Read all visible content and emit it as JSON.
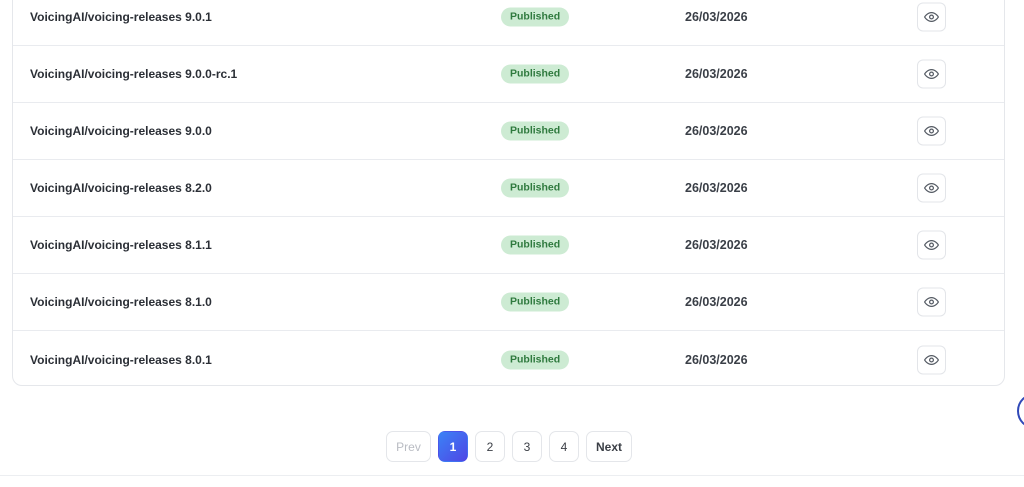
{
  "releases": [
    {
      "name": "VoicingAI/voicing-releases 9.0.1",
      "status": "Published",
      "date": "26/03/2026"
    },
    {
      "name": "VoicingAI/voicing-releases 9.0.0-rc.1",
      "status": "Published",
      "date": "26/03/2026"
    },
    {
      "name": "VoicingAI/voicing-releases 9.0.0",
      "status": "Published",
      "date": "26/03/2026"
    },
    {
      "name": "VoicingAI/voicing-releases 8.2.0",
      "status": "Published",
      "date": "26/03/2026"
    },
    {
      "name": "VoicingAI/voicing-releases 8.1.1",
      "status": "Published",
      "date": "26/03/2026"
    },
    {
      "name": "VoicingAI/voicing-releases 8.1.0",
      "status": "Published",
      "date": "26/03/2026"
    },
    {
      "name": "VoicingAI/voicing-releases 8.0.1",
      "status": "Published",
      "date": "26/03/2026"
    }
  ],
  "view_icon": "eye-icon",
  "pagination": {
    "prev": "Prev",
    "pages": [
      "1",
      "2",
      "3",
      "4"
    ],
    "current": "1",
    "next": "Next"
  },
  "colors": {
    "badge_bg": "#cdebd3",
    "badge_text": "#2f7a3e",
    "active_page_start": "#3b82f6",
    "active_page_end": "#4f46e5"
  }
}
